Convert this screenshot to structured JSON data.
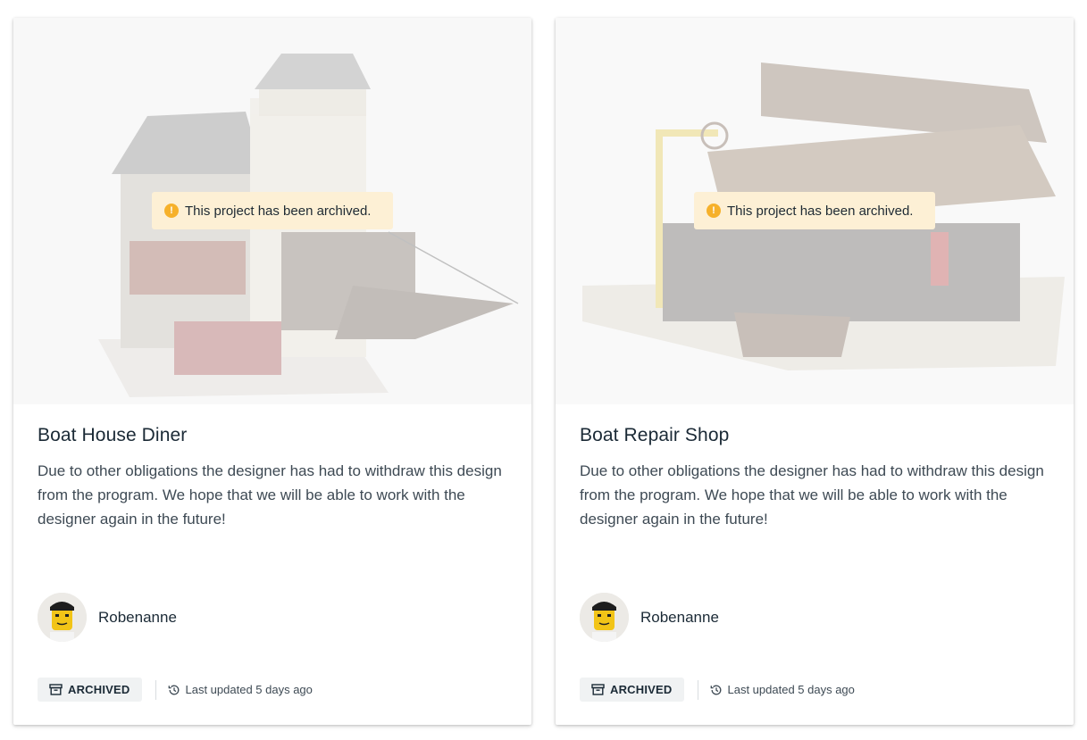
{
  "cards": [
    {
      "title": "Boat House Diner",
      "notice": "This project has been archived.",
      "description": "Due to other obligations the designer has had to withdraw this design from the program. We hope that we will be able to work with the designer again in the future!",
      "author": "Robenanne",
      "status": "ARCHIVED",
      "updated": "Last updated 5 days ago"
    },
    {
      "title": "Boat Repair Shop",
      "notice": "This project has been archived.",
      "description": "Due to other obligations the designer has had to withdraw this design from the program. We hope that we will be able to work with the designer again in the future!",
      "author": "Robenanne",
      "status": "ARCHIVED",
      "updated": "Last updated 5 days ago"
    }
  ],
  "icons": {
    "notice": "warning-icon",
    "status": "archive-box-icon",
    "updated": "history-clock-icon"
  },
  "colors": {
    "notice_bg": "#fdf0d5",
    "warning": "#f6b12b",
    "badge_bg": "#f0f2f3",
    "text": "#1b2a36"
  }
}
